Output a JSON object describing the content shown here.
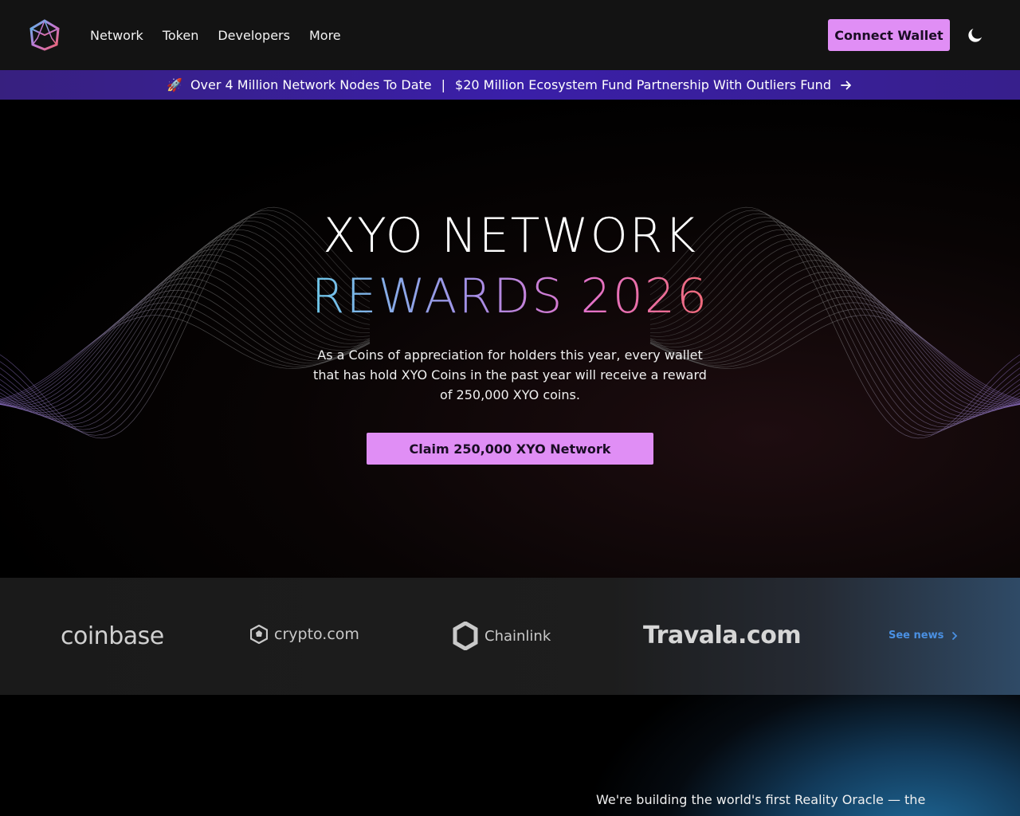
{
  "header": {
    "nav": [
      "Network",
      "Token",
      "Developers",
      "More"
    ],
    "connect_label": "Connect Wallet"
  },
  "announcement": {
    "icon": "rocket-icon",
    "part1": "Over 4 Million Network Nodes To Date",
    "separator": "|",
    "part2": "$20 Million Ecosystem Fund Partnership With Outliers Fund"
  },
  "hero": {
    "title_line1": "XYO NETWORK",
    "title_line2": "REWARDS 2026",
    "description": "As a Coins of appreciation for holders this year, every wallet that has hold XYO Coins in the past year will receive a reward of 250,000 XYO coins.",
    "cta_label": "Claim 250,000 XYO Network"
  },
  "partners": {
    "logos": [
      "coinbase",
      "crypto.com",
      "Chainlink",
      "Travala.com"
    ],
    "see_news": "See news"
  },
  "intro": {
    "text": "We're building the world's first Reality Oracle — the"
  },
  "colors": {
    "accent": "#e08ef5",
    "announce_bg": "#3a1fa8",
    "link": "#4a90e2"
  }
}
